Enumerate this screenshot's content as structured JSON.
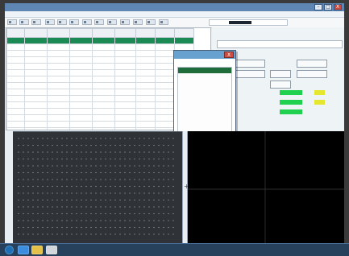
{
  "window": {
    "title": "",
    "close_label": "X",
    "min_label": "–",
    "max_label": "□"
  },
  "menubar": {
    "items": [
      "",
      "",
      "",
      "",
      "",
      "",
      "",
      "",
      "",
      "",
      ""
    ]
  },
  "toolbar": {
    "status_label": "",
    "status_value": ""
  },
  "table": {
    "columns": [
      "",
      "",
      "",
      "",
      "",
      "",
      "",
      "",
      ""
    ],
    "rows": [
      [
        "",
        "",
        "",
        "",
        "",
        "",
        "",
        "",
        ""
      ],
      [
        "",
        "",
        "",
        "",
        "",
        "",
        "",
        "",
        ""
      ],
      [
        "",
        "",
        "",
        "",
        "",
        "",
        "",
        "",
        ""
      ],
      [
        "",
        "",
        "",
        "",
        "",
        "",
        "",
        "",
        ""
      ],
      [
        "",
        "",
        "",
        "",
        "",
        "",
        "",
        "",
        ""
      ],
      [
        "",
        "",
        "",
        "",
        "",
        "",
        "",
        "",
        ""
      ],
      [
        "",
        "",
        "",
        "",
        "",
        "",
        "",
        "",
        ""
      ],
      [
        "",
        "",
        "",
        "",
        "",
        "",
        "",
        "",
        ""
      ],
      [
        "",
        "",
        "",
        "",
        "",
        "",
        "",
        "",
        ""
      ],
      [
        "",
        "",
        "",
        "",
        "",
        "",
        "",
        "",
        ""
      ],
      [
        "",
        "",
        "",
        "",
        "",
        "",
        "",
        "",
        ""
      ],
      [
        "",
        "",
        "",
        "",
        "",
        "",
        "",
        "",
        ""
      ],
      [
        "",
        "",
        "",
        "",
        "",
        "",
        "",
        "",
        ""
      ],
      [
        "",
        "",
        "",
        "",
        "",
        "",
        "",
        "",
        ""
      ],
      [
        "",
        "",
        "",
        "",
        "",
        "",
        "",
        "",
        ""
      ]
    ]
  },
  "right_panel": {
    "label_top": "",
    "label_mid": "",
    "buttons": [
      "",
      "",
      "",
      "",
      "",
      ""
    ],
    "small_labels": [
      "",
      "",
      ""
    ]
  },
  "popup": {
    "title": "",
    "subtitle": "",
    "close_label": "X",
    "ok_label": "",
    "items": [
      {
        "num": "",
        "text": ""
      },
      {
        "num": "",
        "text": ""
      },
      {
        "num": "",
        "text": ""
      },
      {
        "num": "",
        "text": ""
      },
      {
        "num": "",
        "text": ""
      },
      {
        "num": "",
        "text": ""
      },
      {
        "num": "",
        "text": ""
      },
      {
        "num": "",
        "text": ""
      },
      {
        "num": "",
        "text": ""
      },
      {
        "num": "",
        "text": ""
      },
      {
        "num": "",
        "text": ""
      },
      {
        "num": "",
        "text": ""
      },
      {
        "num": "",
        "text": ""
      }
    ]
  },
  "tray": {
    "status_text": "",
    "time": "",
    "date": ""
  },
  "colors": {
    "selection_green": "#1c8a54",
    "indicator_green": "#1fd14f",
    "indicator_yellow": "#e5e72e",
    "popup_title": "#66a1cf",
    "close_red": "#cf4a3f"
  },
  "icons": {
    "start": "windows-start-icon",
    "browser": "ie-icon",
    "folder": "folder-icon",
    "app": "app-icon"
  }
}
